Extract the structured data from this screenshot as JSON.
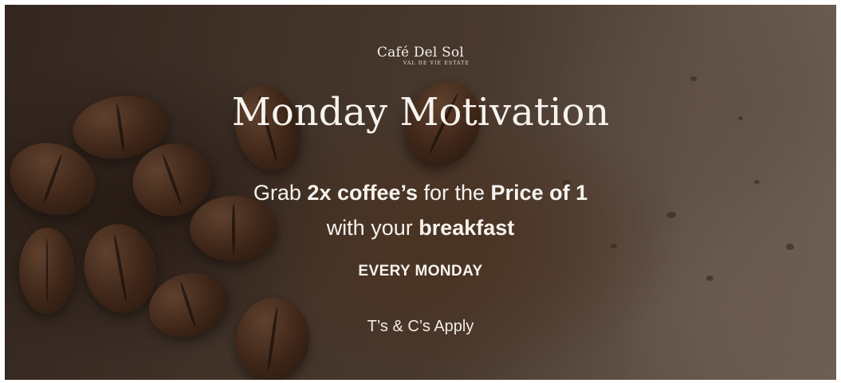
{
  "brand": {
    "name": "Café Del Sol",
    "subtitle": "VAL DE VIE ESTATE"
  },
  "headline": "Monday Motivation",
  "offer": {
    "line1_part1": "Grab ",
    "line1_bold1": "2x coffee’s",
    "line1_part2": " for the ",
    "line1_bold2": "Price of 1",
    "line2_part1": "with your ",
    "line2_bold": "breakfast"
  },
  "schedule": "EVERY MONDAY",
  "terms": "T’s & C’s Apply",
  "colors": {
    "text": "#f7f3ee",
    "background_dark": "#3c2d24",
    "background_light": "#8e7d70"
  }
}
